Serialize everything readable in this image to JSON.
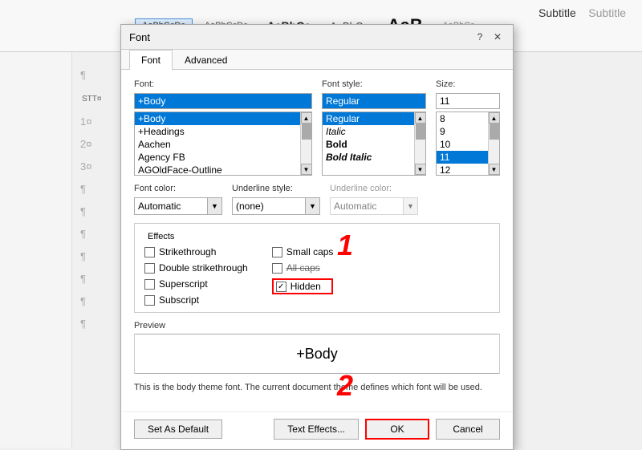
{
  "ribbon": {
    "styles": [
      {
        "id": "s1",
        "label": "AaBbCcDc",
        "class": "style-aabbcc-1",
        "active": true
      },
      {
        "id": "s2",
        "label": "AaBbCcDc",
        "class": "style-aabbcc-2",
        "active": false
      },
      {
        "id": "s3",
        "label": "AaBbCc",
        "class": "style-aabbcc-3",
        "active": false
      },
      {
        "id": "s4",
        "label": "AaBbCc",
        "class": "style-aabbcc-4",
        "active": false
      },
      {
        "id": "s5",
        "label": "AaB",
        "class": "style-aabbcc-5",
        "active": false
      },
      {
        "id": "s6",
        "label": "AaBbCc",
        "class": "style-aabbcc-6",
        "active": false
      }
    ],
    "subtitle_label": "Subtitle"
  },
  "dialog": {
    "title": "Font",
    "help_label": "?",
    "close_label": "✕",
    "tabs": [
      {
        "id": "font",
        "label": "Font",
        "active": true
      },
      {
        "id": "advanced",
        "label": "Advanced",
        "active": false
      }
    ],
    "font_label": "Font:",
    "font_value": "+Body",
    "font_items": [
      "+Body",
      "+Headings",
      "Aachen",
      "Agency FB",
      "AGOldFace-Outline"
    ],
    "font_selected": "+Body",
    "style_label": "Font style:",
    "style_value": "Regular",
    "style_items": [
      "Regular",
      "Italic",
      "Bold",
      "Bold Italic"
    ],
    "style_selected": "Regular",
    "size_label": "Size:",
    "size_value": "11",
    "size_items": [
      "8",
      "9",
      "10",
      "11",
      "12"
    ],
    "size_selected": "11",
    "font_color_label": "Font color:",
    "font_color_value": "Automatic",
    "underline_style_label": "Underline style:",
    "underline_style_value": "(none)",
    "underline_color_label": "Underline color:",
    "underline_color_value": "Automatic",
    "effects_title": "Effects",
    "effects": [
      {
        "id": "strikethrough",
        "label": "Strikethrough",
        "checked": false
      },
      {
        "id": "double_strikethrough",
        "label": "Double strikethrough",
        "checked": false
      },
      {
        "id": "superscript",
        "label": "Superscript",
        "checked": false
      },
      {
        "id": "subscript",
        "label": "Subscript",
        "checked": false
      }
    ],
    "effects_right": [
      {
        "id": "small_caps",
        "label": "Small caps",
        "checked": false
      },
      {
        "id": "all_caps",
        "label": "All caps",
        "checked": false,
        "strikethrough": true
      },
      {
        "id": "hidden",
        "label": "Hidden",
        "checked": true,
        "highlight": true
      }
    ],
    "preview_label": "Preview",
    "preview_text": "+Body",
    "description": "This is the body theme font. The current document theme defines which font will be used.",
    "btn_default": "Set As Default",
    "btn_effects": "Text Effects...",
    "btn_ok": "OK",
    "btn_cancel": "Cancel"
  },
  "annotations": {
    "num1": "1",
    "num2": "2"
  },
  "doc": {
    "para_marks": [
      "¶",
      "¶",
      "¶",
      "¶",
      "¶",
      "¶",
      "¶"
    ],
    "stt_line": "STT¤",
    "lines": [
      "1¤",
      "2¤",
      "3¤"
    ]
  }
}
